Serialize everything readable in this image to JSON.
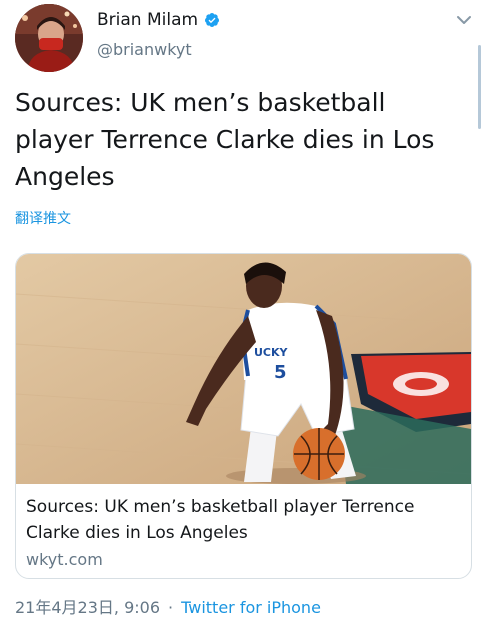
{
  "author": {
    "name": "Brian Milam",
    "handle": "@brianwkyt",
    "verified": true
  },
  "tweet": {
    "text": "Sources: UK men’s basketball player Terrence Clarke dies in Los Angeles",
    "translate_label": "翻译推文"
  },
  "card": {
    "title": "Sources: UK men’s basketball player Terrence Clarke dies in Los Angeles",
    "domain": "wkyt.com",
    "image_alt": "UK basketball player dribbling"
  },
  "meta": {
    "timestamp": "21年4月23日, 9:06",
    "separator": "·",
    "source": "Twitter for iPhone"
  },
  "colors": {
    "accent": "#1b95e0",
    "secondary_text": "#657786",
    "verified": "#1da1f2"
  },
  "icons": {
    "verified": "verified-badge-icon",
    "menu": "chevron-down-icon"
  }
}
